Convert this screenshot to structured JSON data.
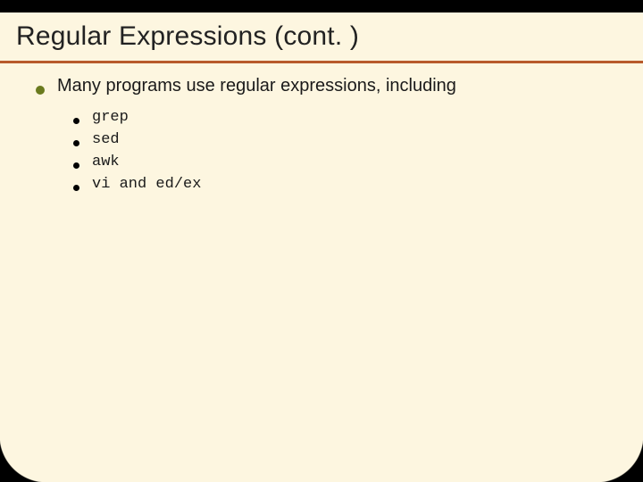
{
  "title": "Regular Expressions (cont. )",
  "main_bullet": "Many programs use regular expressions, including",
  "sub_bullets": [
    "grep",
    "sed",
    "awk",
    "vi and ed/ex"
  ],
  "colors": {
    "background": "#fdf6e0",
    "accent": "#b85a2b",
    "bullet_primary": "#6a7a1e",
    "header_bar": "#000000"
  }
}
